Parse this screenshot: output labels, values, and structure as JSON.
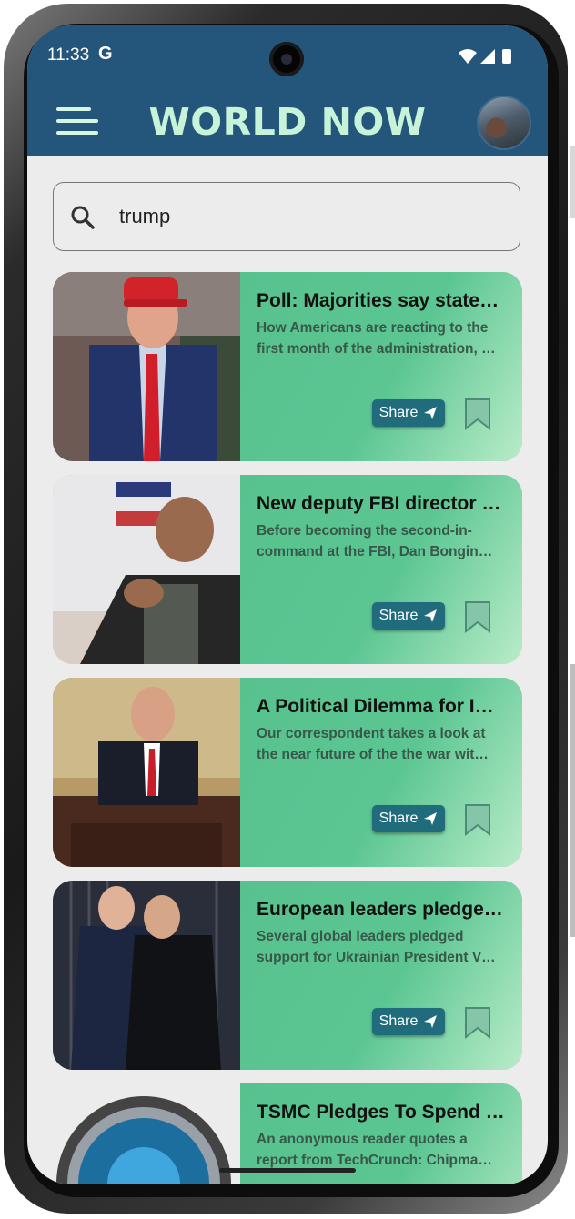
{
  "status": {
    "time": "11:33",
    "g": "G"
  },
  "app": {
    "title": "WORLD NOW"
  },
  "search": {
    "value": "trump",
    "placeholder": ""
  },
  "articles": [
    {
      "title": "Poll: Majorities say state…",
      "description": "How Americans are reacting to the first month of the administration, …",
      "share_label": "Share"
    },
    {
      "title": "New deputy FBI director …",
      "description": "Before becoming the second-in-command at the FBI, Dan Bongin…",
      "share_label": "Share"
    },
    {
      "title": "A Political Dilemma for I…",
      "description": "Our correspondent takes a look at the near future of the the war wit…",
      "share_label": "Share"
    },
    {
      "title": "European leaders pledge…",
      "description": "Several global leaders pledged support for Ukrainian President V…",
      "share_label": "Share"
    },
    {
      "title": "TSMC Pledges To Spend …",
      "description": "An anonymous reader quotes a report from TechCrunch: Chipma…",
      "share_label": "Share"
    }
  ],
  "colors": {
    "appbar": "#24567c",
    "title": "#c7f3d8",
    "card": "#5cc391",
    "share": "#206c7d"
  },
  "icons": [
    "menu-icon",
    "search-icon",
    "send-icon",
    "bookmark-icon",
    "wifi-icon",
    "signal-icon",
    "battery-icon"
  ]
}
